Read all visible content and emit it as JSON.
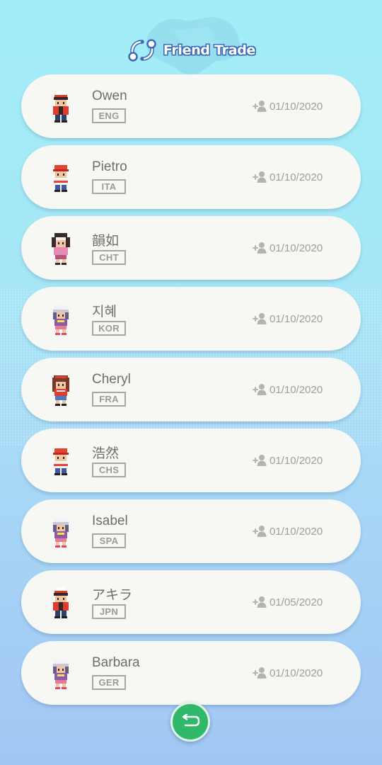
{
  "header": {
    "title": "Friend Trade",
    "icon": "trade-icon"
  },
  "trades": [
    {
      "name": "Owen",
      "lang": "ENG",
      "date": "01/10/2020",
      "avatar": "trainer-male-cap"
    },
    {
      "name": "Pietro",
      "lang": "ITA",
      "date": "01/10/2020",
      "avatar": "trainer-red-hat"
    },
    {
      "name": "韻如",
      "lang": "CHT",
      "date": "01/10/2020",
      "avatar": "trainer-female-pink"
    },
    {
      "name": "지혜",
      "lang": "KOR",
      "date": "01/10/2020",
      "avatar": "trainer-female-white"
    },
    {
      "name": "Cheryl",
      "lang": "FRA",
      "date": "01/10/2020",
      "avatar": "trainer-female-red"
    },
    {
      "name": "浩然",
      "lang": "CHS",
      "date": "01/10/2020",
      "avatar": "trainer-red-hat"
    },
    {
      "name": "Isabel",
      "lang": "SPA",
      "date": "01/10/2020",
      "avatar": "trainer-female-white"
    },
    {
      "name": "アキラ",
      "lang": "JPN",
      "date": "01/05/2020",
      "avatar": "trainer-male-cap"
    },
    {
      "name": "Barbara",
      "lang": "GER",
      "date": "01/10/2020",
      "avatar": "trainer-female-white"
    }
  ],
  "back_button": {
    "icon": "return-arrow-icon"
  },
  "colors": {
    "accent": "#2fb86a",
    "title_outline": "#3b6ab6",
    "card": "#f7f8f3"
  }
}
